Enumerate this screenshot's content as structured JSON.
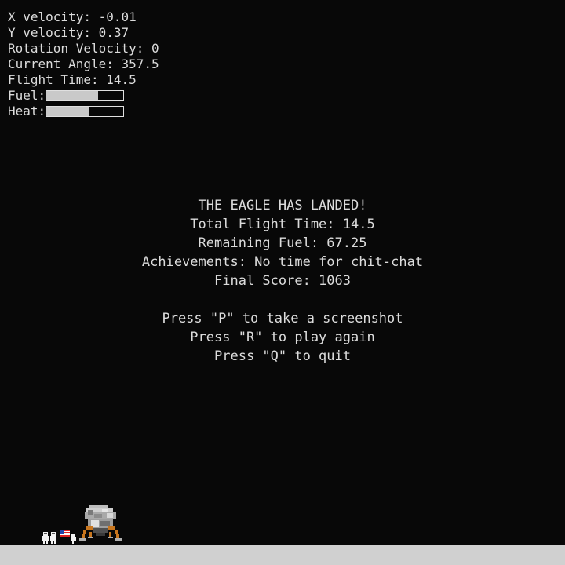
{
  "hud": {
    "x_velocity": "X velocity: -0.01",
    "y_velocity": "Y velocity: 0.37",
    "rotation_velocity": "Rotation Velocity: 0",
    "current_angle": "Current Angle: 357.5",
    "flight_time": "Flight Time: 14.5",
    "fuel_label": "Fuel:",
    "fuel_level": 0.67,
    "heat_label": "Heat:",
    "heat_level": 0.55
  },
  "end_screen": {
    "title": "THE EAGLE HAS LANDED!",
    "total_flight_time": "Total Flight Time: 14.5",
    "remaining_fuel": "Remaining Fuel: 67.25",
    "achievements": "Achievements: No time for chit-chat",
    "final_score": "Final Score: 1063",
    "press_p": "Press \"P\" to take a screenshot",
    "press_r": "Press \"R\" to play again",
    "press_q": "Press \"Q\" to quit"
  },
  "sprites": {
    "lander": "lunar-module-icon",
    "astronauts": "astronauts-with-flag-icon"
  },
  "colors": {
    "background": "#080808",
    "text": "#dcdcdc",
    "ground": "#d0d0d0",
    "lander_legs": "#c8761e"
  }
}
